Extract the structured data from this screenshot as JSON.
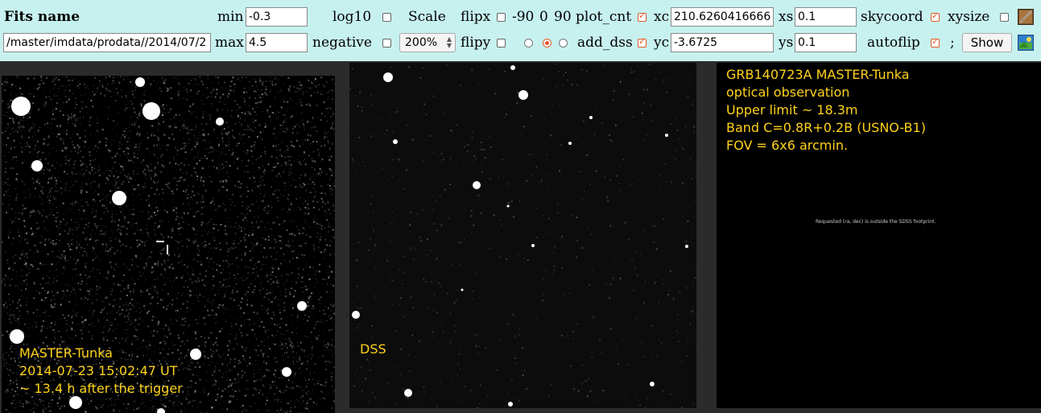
{
  "toolbar": {
    "fits_name_label": "Fits name",
    "path_value": "/master/imdata/prodata//2014/07/2",
    "min_label": "min",
    "min_value": "-0.3",
    "max_label": "max",
    "max_value": "4.5",
    "log10_label": "log10",
    "negative_label": "negative",
    "scale_label": "Scale",
    "scale_value": "200%",
    "flipx_label": "flipx",
    "flipy_label": "flipy",
    "rotation_options": [
      "-90",
      "0",
      "90"
    ],
    "rotation_selected": "0",
    "plot_cnt_label": "plot_cnt",
    "add_dss_label": "add_dss",
    "xc_label": "xc",
    "xc_value": "210.6260416666",
    "yc_label": "yc",
    "yc_value": "-3.6725",
    "xs_label": "xs",
    "xs_value": "0.1",
    "ys_label": "ys",
    "ys_value": "0.1",
    "skycoord_label": "skycoord",
    "autoflip_label": "autoflip",
    "xysize_label": "xysize",
    "semicolon": ";",
    "show_label": "Show",
    "checks": {
      "log10": false,
      "negative": false,
      "flipx": false,
      "flipy": false,
      "plot_cnt": true,
      "add_dss": true,
      "skycoord": true,
      "autoflip": true,
      "xysize": false
    }
  },
  "master_panel": {
    "caption_line1": "MASTER-Tunka",
    "caption_line2": "2014-07-23 15:02:47 UT",
    "caption_line3": "~ 13.4 h after the trigger"
  },
  "dss_panel": {
    "caption": "DSS"
  },
  "info_panel": {
    "line1": "GRB140723A MASTER-Tunka",
    "line2": "optical observation",
    "line3": "Upper limit ~ 18.3m",
    "line4": "Band C=0.8R+0.2B (USNO-B1)",
    "line5": "FOV = 6x6 arcmin.",
    "sdss_note": "Requested (ra, dec) is outside the SDSS footprint."
  },
  "colors": {
    "toolbar_bg": "#c7f1ef",
    "caption": "#ffd21a",
    "check_accent": "#e05a2a"
  }
}
